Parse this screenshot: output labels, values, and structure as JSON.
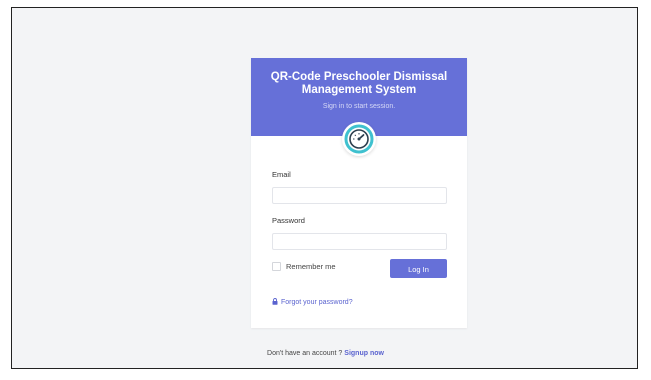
{
  "header": {
    "title": "QR-Code Preschooler Dismissal Management System",
    "subtitle": "Sign in to start session."
  },
  "form": {
    "email_label": "Email",
    "password_label": "Password",
    "remember_label": "Remember me",
    "login_label": "Log In",
    "email_value": "",
    "password_value": ""
  },
  "forgot_label": "Forgot your password?",
  "signup": {
    "prompt": "Don't have an account ?",
    "link": "Signup now"
  },
  "colors": {
    "accent": "#6670d8",
    "logo_ring": "#3fc1cf"
  },
  "icons": {
    "logo": "speedometer-icon",
    "forgot": "lock-icon"
  }
}
